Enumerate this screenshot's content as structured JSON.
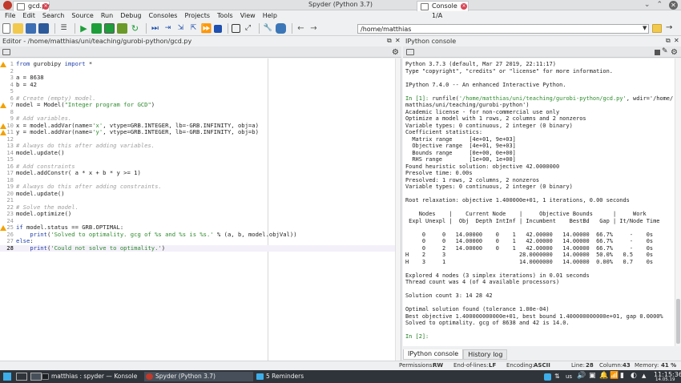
{
  "window": {
    "title": "Spyder (Python 3.7)"
  },
  "menu": [
    "File",
    "Edit",
    "Search",
    "Source",
    "Run",
    "Debug",
    "Consoles",
    "Projects",
    "Tools",
    "View",
    "Help"
  ],
  "toolbar": {
    "path": "/home/matthias"
  },
  "editor": {
    "pane_title": "Editor - /home/matthias/uni/teaching/gurobi-python/gcd.py",
    "tab_label": "gcd.py",
    "lines": [
      {
        "n": "1",
        "warn": true,
        "text": "from gurobipy import *"
      },
      {
        "n": "2",
        "warn": false,
        "text": ""
      },
      {
        "n": "3",
        "warn": false,
        "text": "a = 8638"
      },
      {
        "n": "4",
        "warn": false,
        "text": "b = 42"
      },
      {
        "n": "5",
        "warn": false,
        "text": ""
      },
      {
        "n": "6",
        "warn": false,
        "text": "# Create (empty) model."
      },
      {
        "n": "7",
        "warn": true,
        "text": "model = Model(\"Integer program for GCD\")"
      },
      {
        "n": "8",
        "warn": false,
        "text": ""
      },
      {
        "n": "9",
        "warn": false,
        "text": "# Add variables."
      },
      {
        "n": "10",
        "warn": true,
        "text": "x = model.addVar(name='x', vtype=GRB.INTEGER, lb=-GRB.INFINITY, obj=a)"
      },
      {
        "n": "11",
        "warn": true,
        "text": "y = model.addVar(name='y', vtype=GRB.INTEGER, lb=-GRB.INFINITY, obj=b)"
      },
      {
        "n": "12",
        "warn": false,
        "text": ""
      },
      {
        "n": "13",
        "warn": false,
        "text": "# Always do this after adding variables."
      },
      {
        "n": "14",
        "warn": false,
        "text": "model.update()"
      },
      {
        "n": "15",
        "warn": false,
        "text": ""
      },
      {
        "n": "16",
        "warn": false,
        "text": "# Add constraints"
      },
      {
        "n": "17",
        "warn": false,
        "text": "model.addConstr( a * x + b * y >= 1)"
      },
      {
        "n": "18",
        "warn": false,
        "text": ""
      },
      {
        "n": "19",
        "warn": false,
        "text": "# Always do this after adding constraints."
      },
      {
        "n": "20",
        "warn": false,
        "text": "model.update()"
      },
      {
        "n": "21",
        "warn": false,
        "text": ""
      },
      {
        "n": "22",
        "warn": false,
        "text": "# Solve the model."
      },
      {
        "n": "23",
        "warn": false,
        "text": "model.optimize()"
      },
      {
        "n": "24",
        "warn": false,
        "text": ""
      },
      {
        "n": "25",
        "warn": true,
        "text": "if model.status == GRB.OPTIMAL:"
      },
      {
        "n": "26",
        "warn": false,
        "text": "    print('Solved to optimality. gcg of %s and %s is %s.' % (a, b, model.objVal))"
      },
      {
        "n": "27",
        "warn": false,
        "text": "else:"
      },
      {
        "n": "28",
        "warn": false,
        "text": "    print('Could not solve to optimality.')"
      }
    ]
  },
  "console": {
    "pane_title": "IPython console",
    "tab_label": "Console 1/A",
    "lines": [
      "Python 3.7.3 (default, Mar 27 2019, 22:11:17)",
      "Type \"copyright\", \"credits\" or \"license\" for more information.",
      "",
      "IPython 7.4.0 -- An enhanced Interactive Python.",
      "",
      "In [1]: runfile('/home/matthias/uni/teaching/gurobi-python/gcd.py', wdir='/home/",
      "matthias/uni/teaching/gurobi-python')",
      "Academic license - for non-commercial use only",
      "Optimize a model with 1 rows, 2 columns and 2 nonzeros",
      "Variable types: 0 continuous, 2 integer (0 binary)",
      "Coefficient statistics:",
      "  Matrix range     [4e+01, 9e+03]",
      "  Objective range  [4e+01, 9e+03]",
      "  Bounds range     [0e+00, 0e+00]",
      "  RHS range        [1e+00, 1e+00]",
      "Found heuristic solution: objective 42.0000000",
      "Presolve time: 0.00s",
      "Presolved: 1 rows, 2 columns, 2 nonzeros",
      "Variable types: 0 continuous, 2 integer (0 binary)",
      "",
      "Root relaxation: objective 1.400000e+01, 1 iterations, 0.00 seconds",
      "",
      "    Nodes    |    Current Node    |     Objective Bounds      |     Work",
      " Expl Unexpl |  Obj  Depth IntInf | Incumbent    BestBd   Gap | It/Node Time",
      "",
      "     0     0   14.00000    0    1   42.00000   14.00000  66.7%     -    0s",
      "     0     0   14.00000    0    1   42.00000   14.00000  66.7%     -    0s",
      "     0     2   14.00000    0    1   42.00000   14.00000  66.7%     -    0s",
      "H    2     3                      28.0000000   14.00000  50.0%   0.5    0s",
      "H    3     1                      14.0000000   14.00000  0.00%   0.7    0s",
      "",
      "Explored 4 nodes (3 simplex iterations) in 0.01 seconds",
      "Thread count was 4 (of 4 available processors)",
      "",
      "Solution count 3: 14 28 42",
      "",
      "Optimal solution found (tolerance 1.00e-04)",
      "Best objective 1.400000000000e+01, best bound 1.400000000000e+01, gap 0.0000%",
      "Solved to optimality. gcg of 8638 and 42 is 14.0.",
      "",
      "In [2]:"
    ],
    "bottom_tabs": [
      "IPython console",
      "History log"
    ]
  },
  "status": {
    "permissions_label": "Permissions:",
    "permissions": "RW",
    "eol_label": "End-of-lines:",
    "eol": "LF",
    "encoding_label": "Encoding:",
    "encoding": "ASCII",
    "line_label": "Line:",
    "line": "28",
    "column_label": "Column:",
    "column": "43",
    "memory_label": "Memory:",
    "memory": "41 %"
  },
  "taskbar": {
    "items": [
      "matthias : spyder — Konsole",
      "Spyder (Python 3.7)",
      "5 Reminders"
    ],
    "layout": "us",
    "time": "11:15:36",
    "date": "14.05.19"
  },
  "colors": {
    "keyword": "#1f3ea8",
    "string": "#2b8a2b",
    "comment": "#9e9e9e",
    "accent": "#3daee9"
  }
}
